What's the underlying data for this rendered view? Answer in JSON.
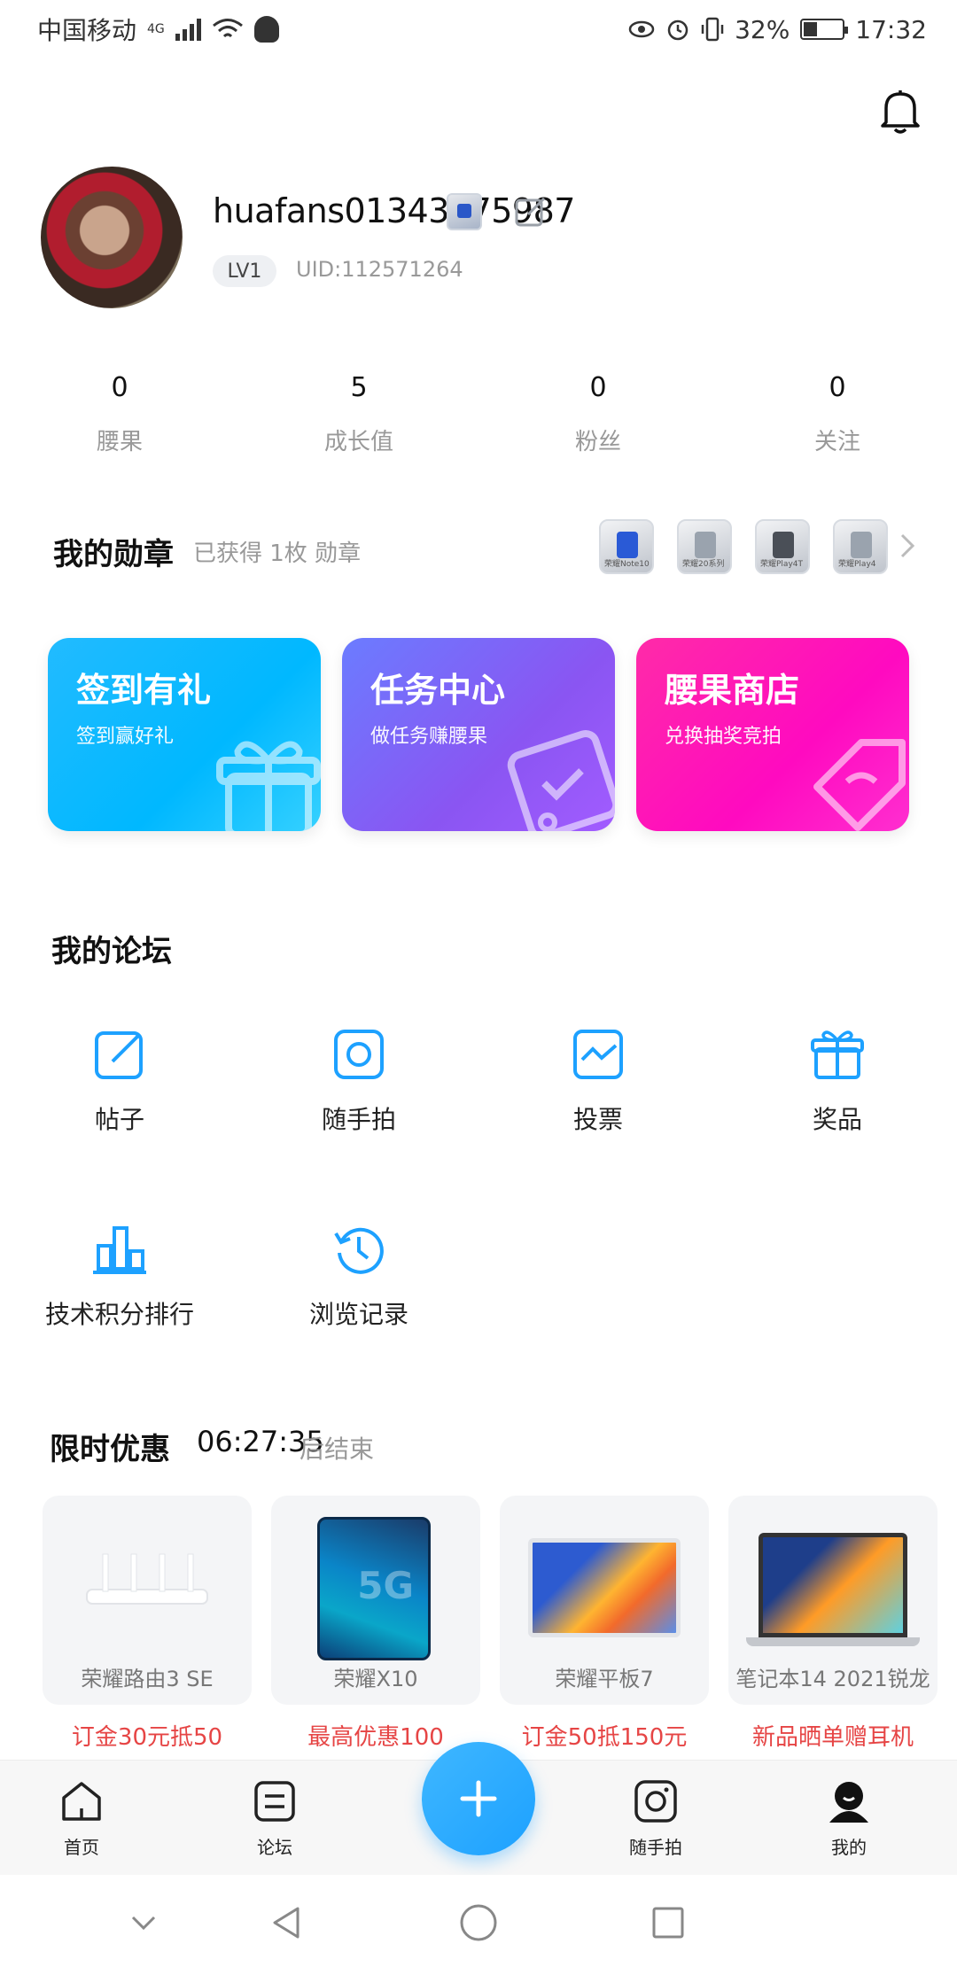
{
  "status_bar": {
    "carrier": "中国移动",
    "network": "4G",
    "battery": "32%",
    "time": "17:32"
  },
  "profile": {
    "username": "huafans01343375987",
    "level": "LV1",
    "uid": "UID:112571264"
  },
  "stats": [
    {
      "value": "0",
      "label": "腰果"
    },
    {
      "value": "5",
      "label": "成长值"
    },
    {
      "value": "0",
      "label": "粉丝"
    },
    {
      "value": "0",
      "label": "关注"
    }
  ],
  "medals": {
    "title": "我的勋章",
    "subtitle": "已获得 1枚 勋章",
    "items": [
      {
        "caption": "荣耀Note10"
      },
      {
        "caption": "荣耀20系列"
      },
      {
        "caption": "荣耀Play4T"
      },
      {
        "caption": "荣耀Play4"
      }
    ]
  },
  "cards": [
    {
      "title": "签到有礼",
      "subtitle": "签到赢好礼"
    },
    {
      "title": "任务中心",
      "subtitle": "做任务赚腰果"
    },
    {
      "title": "腰果商店",
      "subtitle": "兑换抽奖竞拍"
    }
  ],
  "forum": {
    "title": "我的论坛",
    "items": [
      {
        "label": "帖子",
        "icon": "post-icon"
      },
      {
        "label": "随手拍",
        "icon": "camera-icon"
      },
      {
        "label": "投票",
        "icon": "vote-icon"
      },
      {
        "label": "奖品",
        "icon": "gift-icon"
      },
      {
        "label": "技术积分排行",
        "icon": "ranking-icon"
      },
      {
        "label": "浏览记录",
        "icon": "history-icon"
      }
    ]
  },
  "offers": {
    "title": "限时优惠",
    "countdown": "06:27:35",
    "suffix": "后结束",
    "products": [
      {
        "name": "荣耀路由3 SE",
        "promo": "订金30元抵50"
      },
      {
        "name": "荣耀X10",
        "promo": "最高优惠100"
      },
      {
        "name": "荣耀平板7",
        "promo": "订金50抵150元"
      },
      {
        "name": "笔记本14 2021锐龙",
        "promo": "新品晒单赠耳机"
      }
    ]
  },
  "bottom_nav": [
    {
      "label": "首页",
      "icon": "home-icon"
    },
    {
      "label": "论坛",
      "icon": "forum-icon"
    },
    {
      "label": "随手拍",
      "icon": "camera-icon"
    },
    {
      "label": "我的",
      "icon": "profile-icon"
    }
  ],
  "colors": {
    "accent": "#1da1ff",
    "card_signin": "#00b8ff",
    "card_task": "#8a55f2",
    "card_shop": "#ff0ac0",
    "promo": "#e64545",
    "muted": "#999999"
  }
}
